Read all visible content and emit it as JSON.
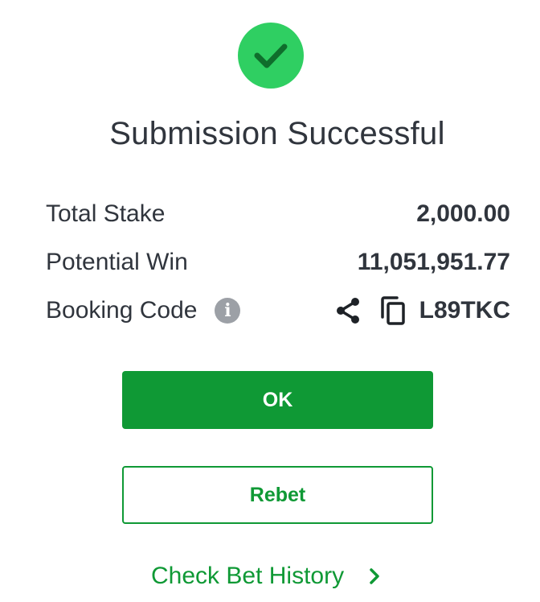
{
  "dialog": {
    "title": "Submission Successful",
    "status_icon": "checkmark-circle-icon"
  },
  "summary": {
    "total_stake_label": "Total Stake",
    "total_stake_value": "2,000.00",
    "potential_win_label": "Potential Win",
    "potential_win_value": "11,051,951.77",
    "booking_code_label": "Booking Code",
    "booking_code_value": "L89TKC",
    "icons": [
      "info-icon",
      "share-icon",
      "copy-icon"
    ]
  },
  "actions": {
    "ok_label": "OK",
    "rebet_label": "Rebet",
    "history_label": "Check Bet History",
    "history_icon": "chevron-right-icon"
  },
  "colors": {
    "success_green": "#2fcf62",
    "brand_green": "#0f9935",
    "text_dark": "#30353d",
    "icon_gray": "#9ca0a6"
  }
}
